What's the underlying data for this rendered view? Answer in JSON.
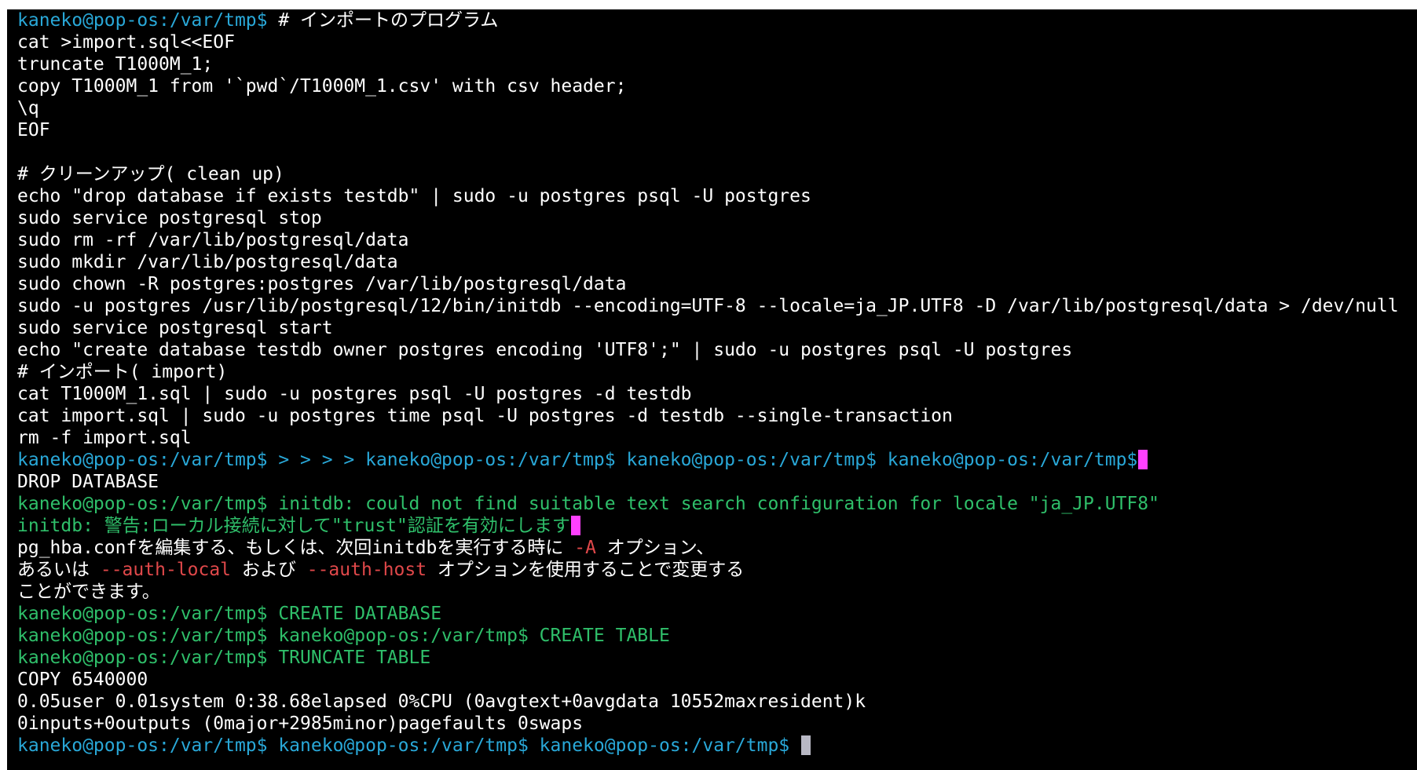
{
  "theme": {
    "background": "#000000",
    "text": "#ffffff",
    "prompt": "#29a8d8",
    "info": "#2fbf6a",
    "option": "#e0484a",
    "cursor_active": "#ff40ff",
    "cursor_idle": "#b8b8c4"
  },
  "lines": [
    [
      {
        "t": "kaneko@pop-os:/var/tmp$ ",
        "c": "prompt"
      },
      {
        "t": "# インポートのプログラム",
        "c": "default"
      }
    ],
    [
      {
        "t": "cat >import.sql<<EOF",
        "c": "default"
      }
    ],
    [
      {
        "t": "truncate T1000M_1;",
        "c": "default"
      }
    ],
    [
      {
        "t": "copy T1000M_1 from '`pwd`/T1000M_1.csv' with csv header;",
        "c": "default"
      }
    ],
    [
      {
        "t": "\\q",
        "c": "default"
      }
    ],
    [
      {
        "t": "EOF",
        "c": "default"
      }
    ],
    [
      {
        "t": "",
        "c": "default"
      }
    ],
    [
      {
        "t": "# クリーンアップ( clean up)",
        "c": "default"
      }
    ],
    [
      {
        "t": "echo \"drop database if exists testdb\" | sudo -u postgres psql -U postgres",
        "c": "default"
      }
    ],
    [
      {
        "t": "sudo service postgresql stop",
        "c": "default"
      }
    ],
    [
      {
        "t": "sudo rm -rf /var/lib/postgresql/data",
        "c": "default"
      }
    ],
    [
      {
        "t": "sudo mkdir /var/lib/postgresql/data",
        "c": "default"
      }
    ],
    [
      {
        "t": "sudo chown -R postgres:postgres /var/lib/postgresql/data",
        "c": "default"
      }
    ],
    [
      {
        "t": "sudo -u postgres /usr/lib/postgresql/12/bin/initdb --encoding=UTF-8 --locale=ja_JP.UTF8 -D /var/lib/postgresql/data > /dev/null",
        "c": "default"
      }
    ],
    [
      {
        "t": "sudo service postgresql start",
        "c": "default"
      }
    ],
    [
      {
        "t": "echo \"create database testdb owner postgres encoding 'UTF8';\" | sudo -u postgres psql -U postgres",
        "c": "default"
      }
    ],
    [
      {
        "t": "# インポート( import)",
        "c": "default"
      }
    ],
    [
      {
        "t": "cat T1000M_1.sql | sudo -u postgres psql -U postgres -d testdb",
        "c": "default"
      }
    ],
    [
      {
        "t": "cat import.sql | sudo -u postgres time psql -U postgres -d testdb --single-transaction",
        "c": "default"
      }
    ],
    [
      {
        "t": "rm -f import.sql",
        "c": "default"
      }
    ],
    [
      {
        "t": "kaneko@pop-os:/var/tmp$ > > > > kaneko@pop-os:/var/tmp$ kaneko@pop-os:/var/tmp$ kaneko@pop-os:/var/tmp$",
        "c": "prompt"
      },
      {
        "cursor": "active"
      }
    ],
    [
      {
        "t": "DROP DATABASE",
        "c": "default"
      }
    ],
    [
      {
        "t": "kaneko@pop-os:/var/tmp$ ",
        "c": "green"
      },
      {
        "t": "initdb: could not find suitable text search configuration for locale \"ja_JP.UTF8\"",
        "c": "green"
      }
    ],
    [
      {
        "t": "initdb: 警告:ローカル接続に対して\"trust\"認証を有効にします",
        "c": "green"
      },
      {
        "cursor": "active"
      }
    ],
    [
      {
        "t": "pg_hba.confを編集する、もしくは、次回initdbを実行する時に ",
        "c": "default"
      },
      {
        "t": "-A",
        "c": "red"
      },
      {
        "t": " オプション、",
        "c": "default"
      }
    ],
    [
      {
        "t": "あるいは ",
        "c": "default"
      },
      {
        "t": "--auth-local",
        "c": "red"
      },
      {
        "t": " および ",
        "c": "default"
      },
      {
        "t": "--auth-host",
        "c": "red"
      },
      {
        "t": " オプションを使用することで変更する",
        "c": "default"
      }
    ],
    [
      {
        "t": "ことができます。",
        "c": "default"
      }
    ],
    [
      {
        "t": "kaneko@pop-os:/var/tmp$ CREATE DATABASE",
        "c": "green"
      }
    ],
    [
      {
        "t": "kaneko@pop-os:/var/tmp$ kaneko@pop-os:/var/tmp$ CREATE TABLE",
        "c": "green"
      }
    ],
    [
      {
        "t": "kaneko@pop-os:/var/tmp$ TRUNCATE TABLE",
        "c": "green"
      }
    ],
    [
      {
        "t": "COPY 6540000",
        "c": "default"
      }
    ],
    [
      {
        "t": "0.05user 0.01system 0:38.68elapsed 0%CPU (0avgtext+0avgdata 10552maxresident)k",
        "c": "default"
      }
    ],
    [
      {
        "t": "0inputs+0outputs (0major+2985minor)pagefaults 0swaps",
        "c": "default"
      }
    ],
    [
      {
        "t": "kaneko@pop-os:/var/tmp$ kaneko@pop-os:/var/tmp$ kaneko@pop-os:/var/tmp$ ",
        "c": "prompt"
      },
      {
        "cursor": "idle"
      }
    ]
  ]
}
